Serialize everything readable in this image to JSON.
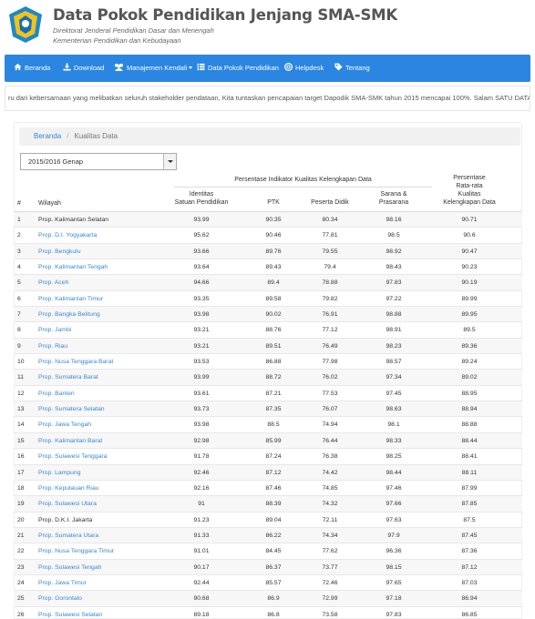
{
  "header": {
    "title": "Data Pokok Pendidikan Jenjang SMA-SMK",
    "subtitle1": "Direktorat Jenderal Pendidikan Dasar dan Menengah",
    "subtitle2": "Kementerian Pendidikan dan Kebudayaan"
  },
  "nav": {
    "beranda": "Beranda",
    "download": "Download",
    "manajemen": "Manajemen Kendali",
    "dapodik": "Data Pokok Pendidikan",
    "helpdesk": "Helpdesk",
    "tentang": "Tentang"
  },
  "marquee": "ru dari kebersamaan yang melibatkan seluruh stakeholder pendataan, Kita tuntaskan pencapaian target Dapodik SMA-SMK tahun 2015 mencapai 100%. Salam SATU DATA DAP",
  "breadcrumb": {
    "home": "Beranda",
    "current": "Kualitas Data"
  },
  "filter": {
    "selected": "2015/2016 Genap"
  },
  "table": {
    "col_no": "#",
    "col_wilayah": "Wilayah",
    "group_header": "Persentase Indikator Kualitas Kelengkapan Data",
    "col_satuan_1": "Identitas",
    "col_satuan_2": "Satuan Pendidikan",
    "col_ptk": "PTK",
    "col_peserta": "Peserta Didik",
    "col_sarana_1": "Sarana &",
    "col_sarana_2": "Prasarana",
    "col_avg_1": "Persentase",
    "col_avg_2": "Rata-rata",
    "col_avg_3": "Kualitas",
    "col_avg_4": "Kelengkapan Data",
    "rows": [
      {
        "no": "1",
        "wilayah": "Prop. Kalimantan Selatan",
        "link": false,
        "a": "93.99",
        "b": "90.35",
        "c": "80.34",
        "d": "98.16",
        "e": "90.71"
      },
      {
        "no": "2",
        "wilayah": "Prop. D.I. Yogyakarta",
        "link": true,
        "a": "95.62",
        "b": "90.46",
        "c": "77.81",
        "d": "98.5",
        "e": "90.6"
      },
      {
        "no": "3",
        "wilayah": "Prop. Bengkulu",
        "link": true,
        "a": "93.66",
        "b": "89.76",
        "c": "79.55",
        "d": "98.92",
        "e": "90.47"
      },
      {
        "no": "4",
        "wilayah": "Prop. Kalimantan Tengah",
        "link": true,
        "a": "93.64",
        "b": "89.43",
        "c": "79.4",
        "d": "98.43",
        "e": "90.23"
      },
      {
        "no": "5",
        "wilayah": "Prop. Aceh",
        "link": true,
        "a": "94.66",
        "b": "89.4",
        "c": "78.88",
        "d": "97.83",
        "e": "90.19"
      },
      {
        "no": "6",
        "wilayah": "Prop. Kalimantan Timur",
        "link": true,
        "a": "93.35",
        "b": "89.58",
        "c": "79.82",
        "d": "97.22",
        "e": "89.99"
      },
      {
        "no": "7",
        "wilayah": "Prop. Bangka Belitung",
        "link": true,
        "a": "93.98",
        "b": "90.02",
        "c": "76.91",
        "d": "98.88",
        "e": "89.95"
      },
      {
        "no": "8",
        "wilayah": "Prop. Jambi",
        "link": true,
        "a": "93.21",
        "b": "88.76",
        "c": "77.12",
        "d": "98.91",
        "e": "89.5"
      },
      {
        "no": "9",
        "wilayah": "Prop. Riau",
        "link": true,
        "a": "93.21",
        "b": "89.51",
        "c": "76.49",
        "d": "98.23",
        "e": "89.36"
      },
      {
        "no": "10",
        "wilayah": "Prop. Nusa Tenggara Barat",
        "link": true,
        "a": "93.53",
        "b": "86.88",
        "c": "77.98",
        "d": "98.57",
        "e": "89.24"
      },
      {
        "no": "11",
        "wilayah": "Prop. Sumatera Barat",
        "link": true,
        "a": "93.99",
        "b": "88.72",
        "c": "76.02",
        "d": "97.34",
        "e": "89.02"
      },
      {
        "no": "12",
        "wilayah": "Prop. Banten",
        "link": true,
        "a": "93.61",
        "b": "87.21",
        "c": "77.53",
        "d": "97.45",
        "e": "88.95"
      },
      {
        "no": "13",
        "wilayah": "Prop. Sumatera Selatan",
        "link": true,
        "a": "93.73",
        "b": "87.35",
        "c": "76.07",
        "d": "98.63",
        "e": "88.94"
      },
      {
        "no": "14",
        "wilayah": "Prop. Jawa Tengah",
        "link": true,
        "a": "93.98",
        "b": "88.5",
        "c": "74.94",
        "d": "98.1",
        "e": "88.88"
      },
      {
        "no": "15",
        "wilayah": "Prop. Kalimantan Barat",
        "link": true,
        "a": "92.98",
        "b": "85.99",
        "c": "76.44",
        "d": "98.33",
        "e": "88.44"
      },
      {
        "no": "16",
        "wilayah": "Prop. Sulawesi Tenggara",
        "link": true,
        "a": "91.78",
        "b": "87.24",
        "c": "76.38",
        "d": "98.25",
        "e": "88.41"
      },
      {
        "no": "17",
        "wilayah": "Prop. Lampung",
        "link": true,
        "a": "92.46",
        "b": "87.12",
        "c": "74.42",
        "d": "98.44",
        "e": "88.11"
      },
      {
        "no": "18",
        "wilayah": "Prop. Kepulauan Riau",
        "link": true,
        "a": "92.16",
        "b": "87.46",
        "c": "74.85",
        "d": "97.46",
        "e": "87.99"
      },
      {
        "no": "19",
        "wilayah": "Prop. Sulawesi Utara",
        "link": true,
        "a": "91",
        "b": "88.39",
        "c": "74.32",
        "d": "97.66",
        "e": "87.85"
      },
      {
        "no": "20",
        "wilayah": "Prop. D.K.I. Jakarta",
        "link": false,
        "a": "91.23",
        "b": "89.04",
        "c": "72.11",
        "d": "97.63",
        "e": "87.5"
      },
      {
        "no": "21",
        "wilayah": "Prop. Sumatera Utara",
        "link": true,
        "a": "91.33",
        "b": "86.22",
        "c": "74.34",
        "d": "97.9",
        "e": "87.45"
      },
      {
        "no": "22",
        "wilayah": "Prop. Nusa Tenggara Timur",
        "link": true,
        "a": "91.01",
        "b": "84.45",
        "c": "77.62",
        "d": "96.36",
        "e": "87.36"
      },
      {
        "no": "23",
        "wilayah": "Prop. Sulawesi Tengah",
        "link": true,
        "a": "90.17",
        "b": "86.37",
        "c": "73.77",
        "d": "98.15",
        "e": "87.12"
      },
      {
        "no": "24",
        "wilayah": "Prop. Jawa Timur",
        "link": true,
        "a": "92.44",
        "b": "85.57",
        "c": "72.46",
        "d": "97.65",
        "e": "87.03"
      },
      {
        "no": "25",
        "wilayah": "Prop. Gorontalo",
        "link": true,
        "a": "90.68",
        "b": "86.9",
        "c": "72.99",
        "d": "97.18",
        "e": "86.94"
      },
      {
        "no": "26",
        "wilayah": "Prop. Sulawesi Selatan",
        "link": true,
        "a": "89.18",
        "b": "86.8",
        "c": "73.58",
        "d": "97.83",
        "e": "86.85"
      }
    ]
  },
  "colors": {
    "nav": "#2a86e0",
    "link": "#3a87d0"
  },
  "icons": [
    "home-icon",
    "download-icon",
    "group-icon",
    "list-icon",
    "support-icon",
    "tag-icon"
  ]
}
